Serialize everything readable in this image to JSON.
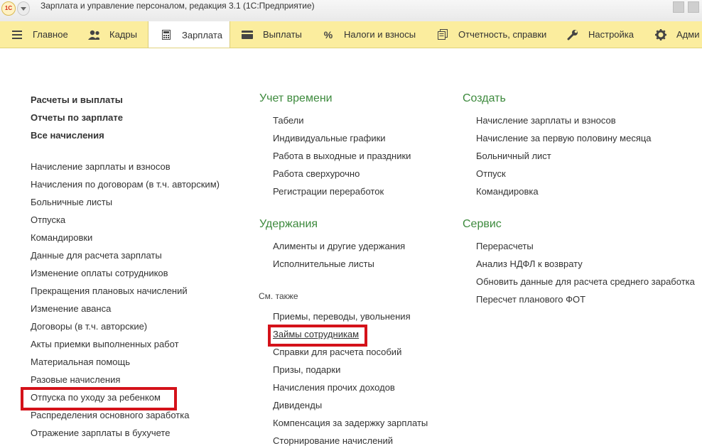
{
  "window": {
    "title": "Зарплата и управление персоналом, редакция 3.1  (1С:Предприятие)",
    "logo_text": "1С"
  },
  "sections": [
    {
      "label": "Главное",
      "icon": "menu-icon"
    },
    {
      "label": "Кадры",
      "icon": "users-icon"
    },
    {
      "label": "Зарплата",
      "icon": "calculator-icon",
      "active": true
    },
    {
      "label": "Выплаты",
      "icon": "wallet-icon"
    },
    {
      "label": "Налоги и взносы",
      "icon": "percent-icon"
    },
    {
      "label": "Отчетность, справки",
      "icon": "documents-icon"
    },
    {
      "label": "Настройка",
      "icon": "wrench-icon"
    },
    {
      "label": "Адми",
      "icon": "gear-icon"
    }
  ],
  "col1": {
    "main_links": [
      "Расчеты и выплаты",
      "Отчеты по зарплате",
      "Все начисления"
    ],
    "links": [
      "Начисление зарплаты и взносов",
      "Начисления по договорам (в т.ч. авторским)",
      "Больничные листы",
      "Отпуска",
      "Командировки",
      "Данные для расчета зарплаты",
      "Изменение оплаты сотрудников",
      "Прекращения плановых начислений",
      "Изменение аванса",
      "Договоры (в т.ч. авторские)",
      "Акты приемки выполненных работ",
      "Материальная помощь",
      "Разовые начисления",
      "Отпуска по уходу за ребенком",
      "Распределения основного заработка",
      "Отражение зарплаты в бухучете"
    ]
  },
  "col2": {
    "time": {
      "header": "Учет времени",
      "links": [
        "Табели",
        "Индивидуальные графики",
        "Работа в выходные и праздники",
        "Работа сверхурочно",
        "Регистрации переработок"
      ]
    },
    "deductions": {
      "header": "Удержания",
      "links": [
        "Алименты и другие удержания",
        "Исполнительные листы"
      ]
    },
    "see_also": {
      "header": "См. также",
      "links": [
        "Приемы, переводы, увольнения",
        "Займы сотрудникам",
        "Справки для расчета пособий",
        "Призы, подарки",
        "Начисления прочих доходов",
        "Дивиденды",
        "Компенсация за задержку зарплаты",
        "Сторнирование начислений"
      ]
    }
  },
  "col3": {
    "create": {
      "header": "Создать",
      "links": [
        "Начисление зарплаты и взносов",
        "Начисление за первую половину месяца",
        "Больничный лист",
        "Отпуск",
        "Командировка"
      ]
    },
    "service": {
      "header": "Сервис",
      "links": [
        "Перерасчеты",
        "Анализ НДФЛ к возврату",
        "Обновить данные для расчета среднего заработка",
        "Пересчет планового ФОТ"
      ]
    }
  },
  "highlight_color": "#d4121a",
  "header_color": "#3d8a3d",
  "section_bar_color": "#fbed9e"
}
